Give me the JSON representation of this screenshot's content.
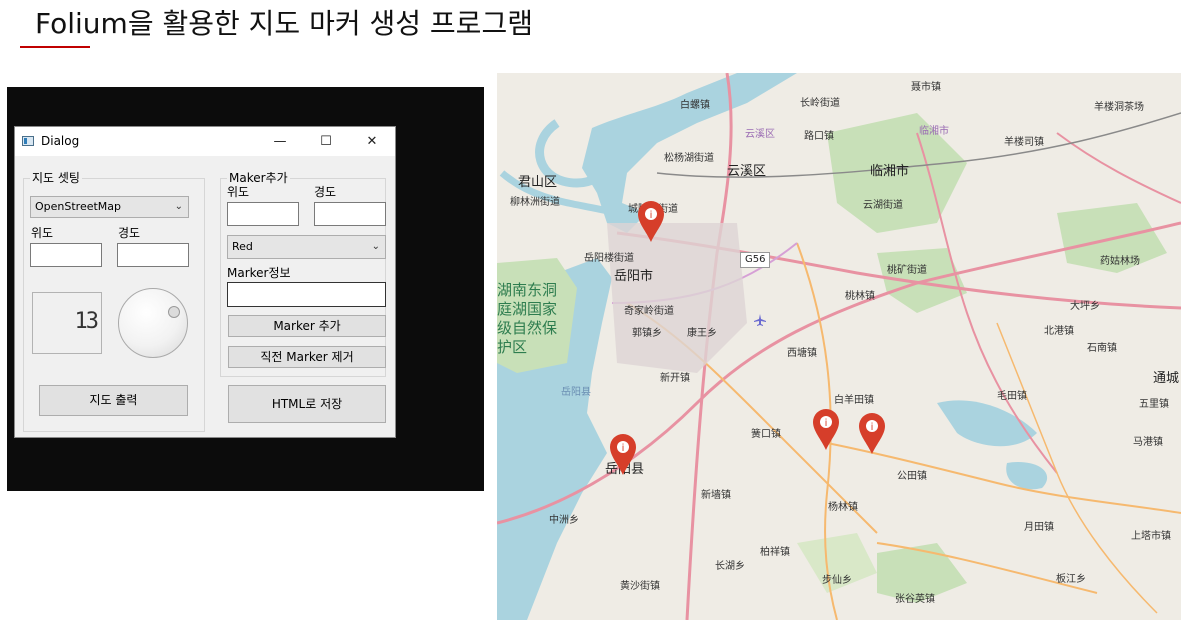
{
  "slide": {
    "title": "Folium을 활용한 지도 마커 생성 프로그램"
  },
  "dialog": {
    "title": "Dialog",
    "controls": {
      "minimize": "—",
      "maximize": "☐",
      "close": "✕"
    },
    "map_settings": {
      "group_title": "지도 셋팅",
      "tile_select": "OpenStreetMap",
      "lat_label": "위도",
      "lon_label": "경도",
      "lat_value": "",
      "lon_value": "",
      "zoom_lcd": "13",
      "print_button": "지도 출력"
    },
    "marker_add": {
      "group_title": "Maker추가",
      "lat_label": "위도",
      "lon_label": "경도",
      "lat_value": "",
      "lon_value": "",
      "color_select": "Red",
      "info_label": "Marker정보",
      "info_value": "",
      "add_button": "Marker 추가",
      "remove_button": "직전 Marker 제거"
    },
    "save_button": "HTML로 저장"
  },
  "map": {
    "labels": {
      "baizhen": "白螺镇",
      "changlingjie": "长岭街道",
      "nieshizhen": "聂市镇",
      "yanglouchang": "羊楼洞茶场",
      "lukou": "路口镇",
      "linxiangshi_pink": "临湘市",
      "yanglousi": "羊楼司镇",
      "yunxiqu_pink": "云溪区",
      "songyang": "松杨湖街道",
      "yunxiqu": "云溪区",
      "linxiangshi": "临湘市",
      "junshanqu": "君山区",
      "liushu": "柳林洲街道",
      "chengling": "城陵矶街道",
      "yunhu": "云湖街道",
      "yueyanglou": "岳阳楼街道",
      "yueyangshi": "岳阳市",
      "g56": "G56",
      "taokuang": "桃矿街道",
      "yaogu": "药姑林场",
      "hunan_park": "湖南东洞庭湖国家级自然保护区",
      "qijiazhen": "奇家岭街道",
      "taolin": "桃林镇",
      "dapingxiang": "大坪乡",
      "guozhen": "郭镇乡",
      "kangwang": "康王乡",
      "beigang": "北港镇",
      "shinan": "石南镇",
      "xitang": "西塘镇",
      "xinkai": "新开镇",
      "yueyang_xian_blue": "岳阳县",
      "maotian": "毛田镇",
      "tongcheng": "通城",
      "baiyangtian": "白羊田镇",
      "wulizhen": "五里镇",
      "huangkou": "簧口镇",
      "magang": "马港镇",
      "yueyangxian": "岳阳县",
      "gongtian": "公田镇",
      "xinqiang": "新墙镇",
      "yanglin": "杨林镇",
      "zhongzhou": "中洲乡",
      "yuetian": "月田镇",
      "shangta": "上塔市镇",
      "bailu": "柏祥镇",
      "changhu": "长湖乡",
      "bushaxiang": "步仙乡",
      "huangsha": "黄沙街镇",
      "zhangguying": "张谷英镇",
      "banjiang": "板江乡"
    }
  }
}
